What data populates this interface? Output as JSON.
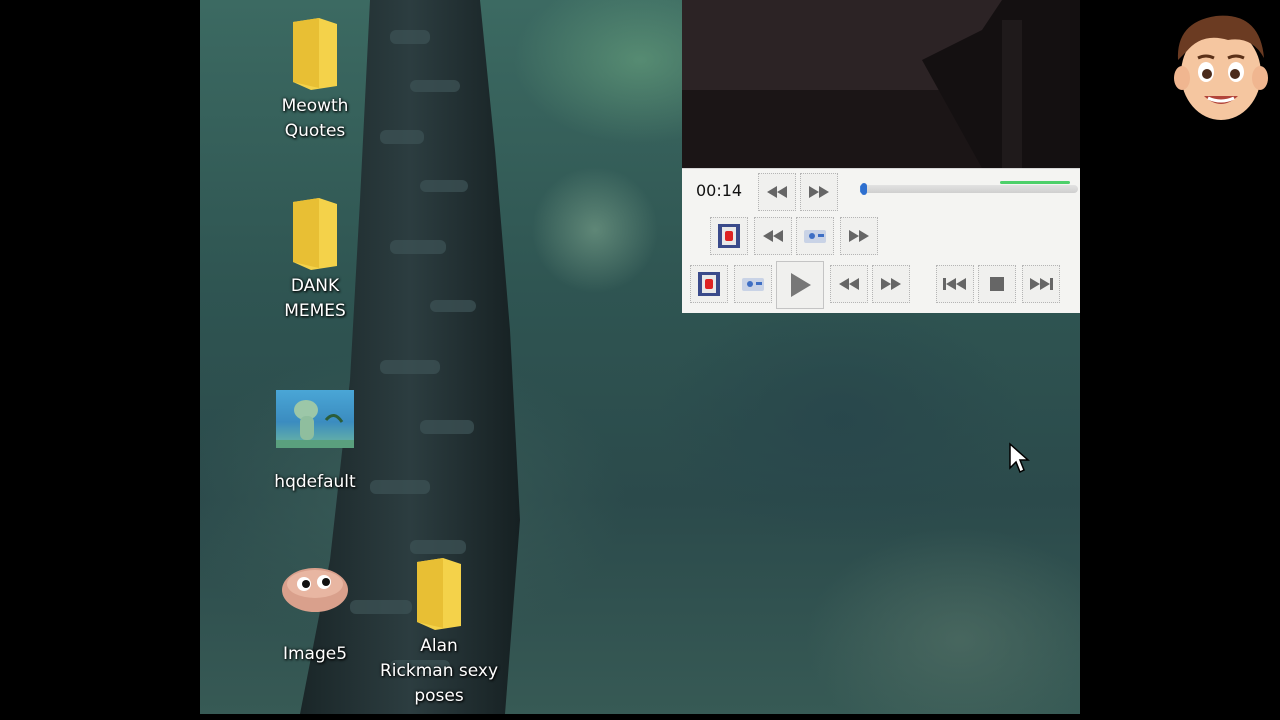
{
  "desktop": {
    "icons": [
      {
        "label": "Meowth\nQuotes",
        "type": "folder"
      },
      {
        "label": "DANK\nMEMES",
        "type": "folder"
      },
      {
        "label": "hqdefault",
        "type": "image"
      },
      {
        "label": "Image5",
        "type": "image"
      },
      {
        "label": "Alan\nRickman sexy\nposes",
        "type": "folder"
      }
    ]
  },
  "player": {
    "time": "00:14",
    "progress_fraction": 0.02
  },
  "colors": {
    "folder": "#f4d24a",
    "seek_fill": "#3d7fd9",
    "controls_bg": "#f4f4f2"
  }
}
